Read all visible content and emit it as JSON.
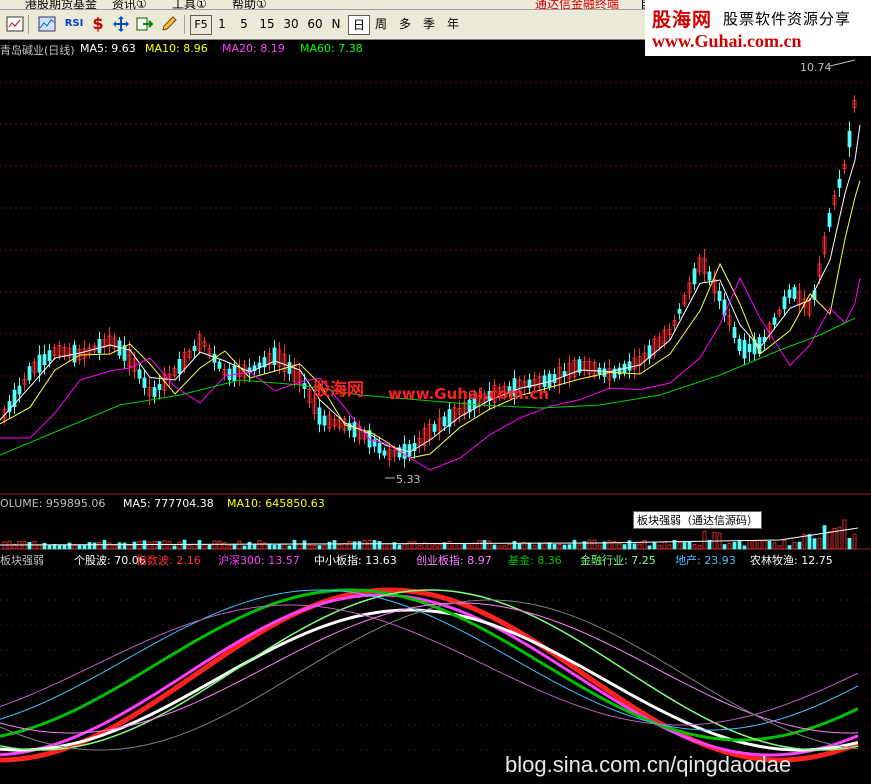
{
  "menu": {
    "items": [
      "港股期货基金",
      "资讯①",
      "工具①",
      "帮助①"
    ],
    "right_link": "通达信金融终端",
    "right_extra": "自"
  },
  "toolbar": {
    "rsi_label": "RSI",
    "fkey": "F5",
    "periods": [
      "1",
      "5",
      "15",
      "30",
      "60",
      "N",
      "日",
      "周",
      "多",
      "季",
      "年"
    ],
    "active_period": "日"
  },
  "banner": {
    "line1": "股海网",
    "line2": "股票软件资源分享",
    "line3": "www.Guhai.com.cn"
  },
  "price_panel": {
    "title": "青岛碱业(日线)",
    "ma5": "MA5: 9.63",
    "ma10": "MA10: 8.96",
    "ma20": "MA20: 8.19",
    "ma60": "MA60: 7.38",
    "high_label": "10.74",
    "low_label": "5.33",
    "watermark1": "股海网",
    "watermark2": "www.Guhai.com.cn",
    "colors": {
      "ma5": "#ffffff",
      "ma10": "#ffff00",
      "ma20": "#ff00ff",
      "ma60": "#00ff00",
      "up": "#ff3232",
      "down": "#54fcfc"
    }
  },
  "volume_panel": {
    "volume": "OLUME: 959895.06",
    "ma5": "MA5: 777704.38",
    "ma10": "MA10: 645850.63",
    "tooltip": "板块强弱（通达信源码）"
  },
  "indicator_panel": {
    "title": "板块强弱",
    "items": [
      {
        "label": "个股波: 70.06",
        "color": "#ffffff"
      },
      {
        "label": "指数波: 2.16",
        "color": "#ff3030"
      },
      {
        "label": "沪深300: 13.57",
        "color": "#ff40ff"
      },
      {
        "label": "中小板指: 13.63",
        "color": "#ffffff"
      },
      {
        "label": "创业板指: 8.97",
        "color": "#ff80ff"
      },
      {
        "label": "基金: 8.36",
        "color": "#00c000"
      },
      {
        "label": "金融行业: 7.25",
        "color": "#80ff80"
      },
      {
        "label": "地产: 23.93",
        "color": "#40c0ff"
      },
      {
        "label": "农林牧渔: 12.75",
        "color": "#ffffff"
      }
    ]
  },
  "footer_watermark": "blog.sina.com.cn/qingdaodae"
}
